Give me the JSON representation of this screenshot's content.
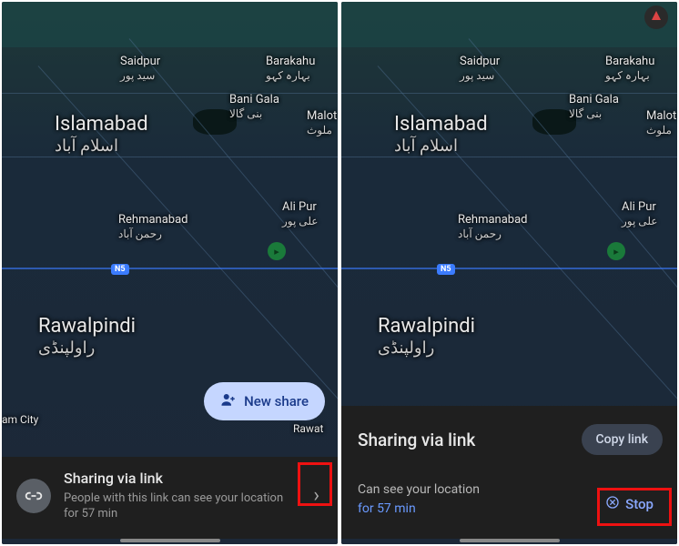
{
  "left": {
    "labels": {
      "saidpur": "Saidpur",
      "saidpur_u": "سید پور",
      "barakahu": "Barakahu",
      "barakahu_u": "بہارہ کہو",
      "banigala": "Bani Gala",
      "banigala_u": "بنی گالا",
      "malot": "Malot",
      "malot_u": "ملوث",
      "islamabad": "Islamabad",
      "islamabad_u": "اسلام آباد",
      "rehmanabad": "Rehmanabad",
      "rehmanabad_u": "رحمن آباد",
      "alipur": "Ali Pur",
      "alipur_u": "علی پور",
      "rawalpindi": "Rawalpindi",
      "rawalpindi_u": "راولپنڈی",
      "rawat": "Rawat",
      "amcity": "am City",
      "n5": "N5"
    },
    "new_share": "New share",
    "sheet": {
      "title": "Sharing via link",
      "desc": "People with this link can see your location for 57 min"
    }
  },
  "right": {
    "labels": {
      "saidpur": "Saidpur",
      "saidpur_u": "سید پور",
      "barakahu": "Barakahu",
      "barakahu_u": "بہارہ کہو",
      "banigala": "Bani Gala",
      "banigala_u": "بنی گالا",
      "malot": "Malot",
      "malot_u": "ملوث",
      "islamabad": "Islamabad",
      "islamabad_u": "اسلام آباد",
      "rehmanabad": "Rehmanabad",
      "rehmanabad_u": "رحمن آباد",
      "alipur": "Ali Pur",
      "alipur_u": "علی پور",
      "rawalpindi": "Rawalpindi",
      "rawalpindi_u": "راولپنڈی",
      "n5": "N5"
    },
    "sheet": {
      "title": "Sharing via link",
      "copy": "Copy link",
      "info": "Can see your location",
      "duration": "for 57 min",
      "stop": "Stop"
    }
  }
}
